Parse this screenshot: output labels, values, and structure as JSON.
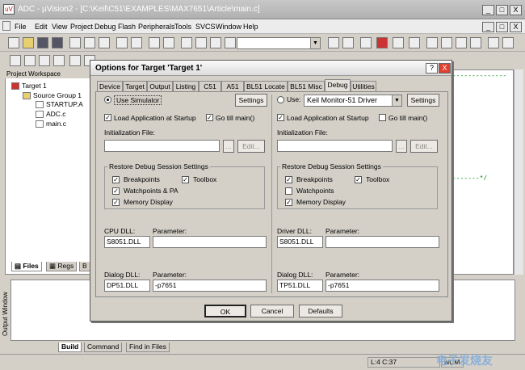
{
  "app": {
    "title": "ADC  - µVision2 - [C:\\Keil\\C51\\EXAMPLES\\MAX7651\\Article\\main.c]",
    "icon_text": "uV"
  },
  "window_buttons": [
    "_",
    "□",
    "X"
  ],
  "doc_buttons": [
    "_",
    "□",
    "X"
  ],
  "menu": [
    "File",
    "Edit",
    "View",
    "Project",
    "Debug",
    "Flash",
    "Peripherals",
    "Tools",
    "SVCS",
    "Window",
    "Help"
  ],
  "toolbar": {
    "combo_value": ""
  },
  "project_workspace": {
    "title": "Project Workspace",
    "items": [
      "Target 1",
      "Source Group 1",
      "STARTUP.A",
      "ADC.c",
      "main.c"
    ],
    "tabs": [
      "Files",
      "Regs",
      "B"
    ]
  },
  "editor": {
    "code_lines": [
      "--------------",
      "-------*/"
    ]
  },
  "output": {
    "label": "Output Window",
    "tabs": [
      "Build",
      "Command",
      "Find in Files"
    ]
  },
  "status": {
    "position": "L:4 C:37",
    "num": "NUM"
  },
  "dialog": {
    "title": "Options for Target 'Target 1'",
    "help": "?",
    "close": "X",
    "tabs": [
      "Device",
      "Target",
      "Output",
      "Listing",
      "C51",
      "A51",
      "BL51 Locate",
      "BL51 Misc",
      "Debug",
      "Utilities"
    ],
    "active_tab": "Debug",
    "left": {
      "mode_label": "Use Simulator",
      "settings": "Settings",
      "load_app": "Load Application at Startup",
      "go_till": "Go  till main()",
      "init_file": "Initialization File:",
      "browse": "...",
      "edit": "Edit...",
      "restore": "Restore Debug Session Settings",
      "breakpoints": "Breakpoints",
      "toolbox": "Toolbox",
      "watchpoints": "Watchpoints & PA",
      "memory": "Memory Display",
      "cpu_dll_label": "CPU DLL:",
      "param_label": "Parameter:",
      "cpu_dll": "S8051.DLL",
      "cpu_param": "",
      "dialog_dll_label": "Dialog DLL:",
      "dialog_param_label": "Parameter:",
      "dialog_dll": "DP51.DLL",
      "dialog_param": "-p7651"
    },
    "right": {
      "mode_label": "Use:",
      "driver": "Keil Monitor-51 Driver",
      "settings": "Settings",
      "load_app": "Load Application at Startup",
      "go_till": "Go  till main()",
      "init_file": "Initialization File:",
      "browse": "...",
      "edit": "Edit...",
      "restore": "Restore Debug Session Settings",
      "breakpoints": "Breakpoints",
      "toolbox": "Toolbox",
      "watchpoints": "Watchpoints",
      "memory": "Memory Display",
      "driver_dll_label": "Driver DLL:",
      "param_label": "Parameter:",
      "driver_dll": "S8051.DLL",
      "driver_param": "",
      "dialog_dll_label": "Dialog DLL:",
      "dialog_param_label": "Parameter:",
      "dialog_dll": "TP51.DLL",
      "dialog_param": "-p7651"
    },
    "buttons": {
      "ok": "OK",
      "cancel": "Cancel",
      "defaults": "Defaults"
    }
  },
  "watermark": "电子发烧友",
  "colors": {
    "title_text": "#ffffff",
    "code_green": "#008000",
    "dialog_bg": "#d4d0c8"
  }
}
